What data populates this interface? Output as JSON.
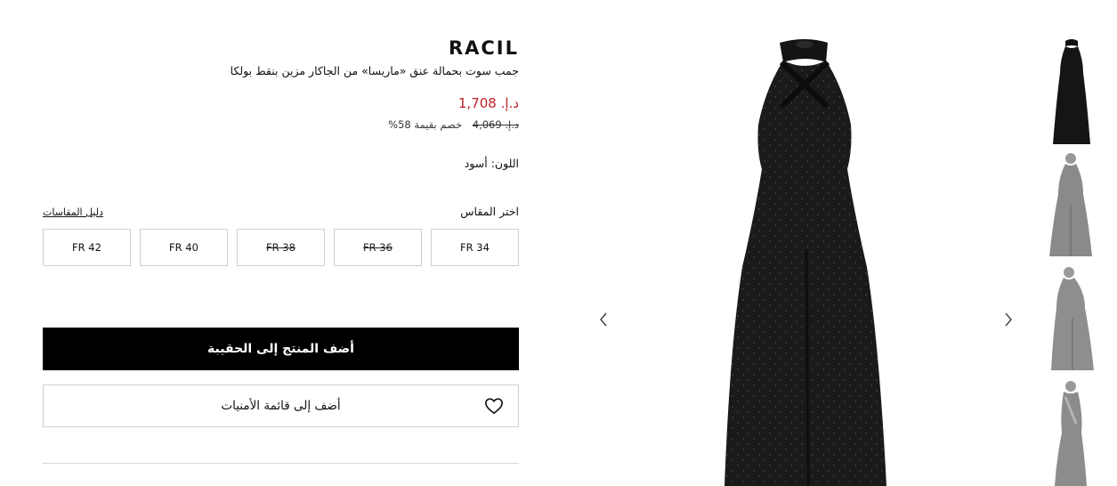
{
  "product": {
    "brand": "RACIL",
    "name": "جمب سوت بحمالة عنق «ماريسا» من الجاكار مزين بنقط بولكا",
    "price_sale": "د.إ. 1,708",
    "price_original": "د.إ. 4,069",
    "discount_text": "خصم بقيمة 58%",
    "color_label": "اللون: أسود"
  },
  "sizes": {
    "label": "اختر المقاس",
    "guide_label": "دليل المقاسات",
    "options": [
      {
        "label": "FR 34",
        "available": true
      },
      {
        "label": "FR 36",
        "available": false
      },
      {
        "label": "FR 38",
        "available": false
      },
      {
        "label": "FR 40",
        "available": true
      },
      {
        "label": "FR 42",
        "available": true
      }
    ]
  },
  "actions": {
    "add_to_bag": "أضف المنتج إلى الحقيبة",
    "add_to_wishlist": "أضف إلى قائمة الأمنيات"
  },
  "colors": {
    "sale_price": "#c0222a",
    "primary_button": "#000000",
    "border": "#cfcfcf"
  },
  "icons": {
    "wishlist": "heart-icon",
    "prev": "chevron-left-icon",
    "next": "chevron-right-icon"
  }
}
